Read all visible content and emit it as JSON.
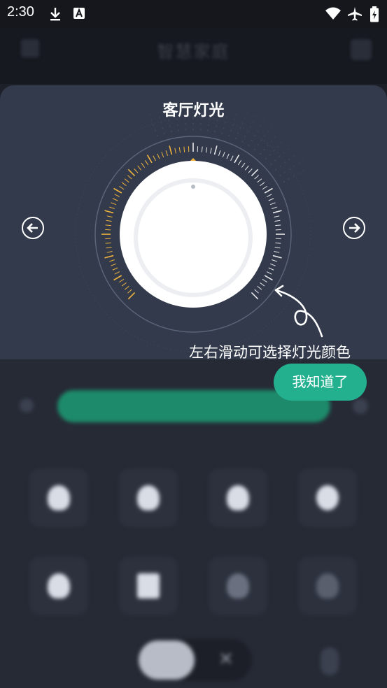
{
  "status_bar": {
    "time": "2:30",
    "icons": [
      "download-icon",
      "a-notification-icon",
      "wifi-icon",
      "airplane-icon",
      "battery-charging-icon"
    ]
  },
  "app_bar": {
    "title": "智慧家庭",
    "left_icon": "menu-icon",
    "right_icon": "home-icon"
  },
  "light_card": {
    "title": "客厅灯光",
    "prev_icon": "arrow-left-circle-icon",
    "next_icon": "arrow-right-circle-icon",
    "accent_color": "#f0b43c",
    "tick_color": "#e8e8ea"
  },
  "guide": {
    "hint": "左右滑动可选择灯光颜色",
    "button_label": "我知道了",
    "button_color": "#23b08f",
    "arrow_icon": "curved-pointer-arrow-icon"
  },
  "background_controls": {
    "brightness_color": "#1d8b6b",
    "modes": [
      "bulb-icon",
      "bulb-icon",
      "bulb-icon",
      "moon-icon",
      "leaf-icon",
      "square-icon",
      "dots-icon",
      "sunrise-icon"
    ],
    "bottom_icons": [
      "toggle-icon",
      "close-icon",
      "mic-icon"
    ]
  }
}
